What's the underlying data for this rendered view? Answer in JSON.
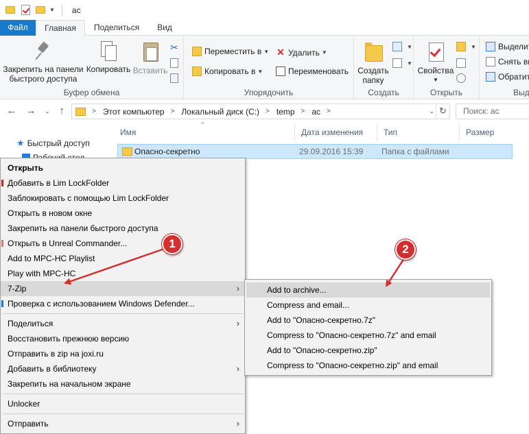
{
  "window": {
    "title": "ac"
  },
  "tabs": {
    "file": "Файл",
    "home": "Главная",
    "share": "Поделиться",
    "view": "Вид"
  },
  "ribbon": {
    "clipboard": {
      "label": "Буфер обмена",
      "pin_line1": "Закрепить на панели",
      "pin_line2": "быстрого доступа",
      "copy": "Копировать",
      "paste": "Вставить"
    },
    "organize": {
      "label": "Упорядочить",
      "move_to": "Переместить в",
      "copy_to": "Копировать в",
      "delete": "Удалить",
      "rename": "Переименовать"
    },
    "create": {
      "label": "Создать",
      "new_folder_line1": "Создать",
      "new_folder_line2": "папку"
    },
    "open": {
      "label": "Открыть",
      "properties": "Свойства"
    },
    "select": {
      "label": "Выд",
      "select_all": "Выделит",
      "deselect": "Снять вы",
      "invert": "Обратит"
    }
  },
  "address": {
    "crumbs": [
      "Этот компьютер",
      "Локальный диск (C:)",
      "temp",
      "ac"
    ],
    "search_placeholder": "Поиск: ac"
  },
  "navpane": {
    "quick_access": "Быстрый доступ",
    "cutoff_item": "Рабочий стол"
  },
  "columns": {
    "name": "Имя",
    "date": "Дата изменения",
    "type": "Тип",
    "size": "Размер"
  },
  "file": {
    "name": "Опасно-секретно",
    "date": "29.09.2016 15:39",
    "type": "Папка с файлами"
  },
  "context_menu": {
    "open": "Открыть",
    "add_lim": "Добавить в Lim LockFolder",
    "lock_lim": "Заблокировать с помощью Lim LockFolder",
    "open_new_window": "Открыть в новом окне",
    "pin_quick": "Закрепить на панели быстрого доступа",
    "open_unreal": "Открыть в Unreal Commander...",
    "add_mpc": "Add to MPC-HC Playlist",
    "play_mpc": "Play with MPC-HC",
    "seven_zip": "7-Zip",
    "defender": "Проверка с использованием Windows Defender...",
    "share": "Поделиться",
    "restore": "Восстановить прежнюю версию",
    "send_zip": "Отправить в zip на joxi.ru",
    "add_library": "Добавить в библиотеку",
    "pin_start": "Закрепить на начальном экране",
    "unlocker": "Unlocker",
    "send_to": "Отправить"
  },
  "submenu": {
    "add_archive": "Add to archive...",
    "compress_email": "Compress and email...",
    "add_7z": "Add to \"Опасно-секретно.7z\"",
    "compress_7z_email": "Compress to \"Опасно-секретно.7z\" and email",
    "add_zip": "Add to \"Опасно-секретно.zip\"",
    "compress_zip_email": "Compress to \"Опасно-секретно.zip\" and email"
  },
  "annotations": {
    "badge1": "1",
    "badge2": "2"
  },
  "colors": {
    "accent": "#1979ca",
    "selection": "#cce8ff",
    "annotation": "#d32f2f"
  }
}
